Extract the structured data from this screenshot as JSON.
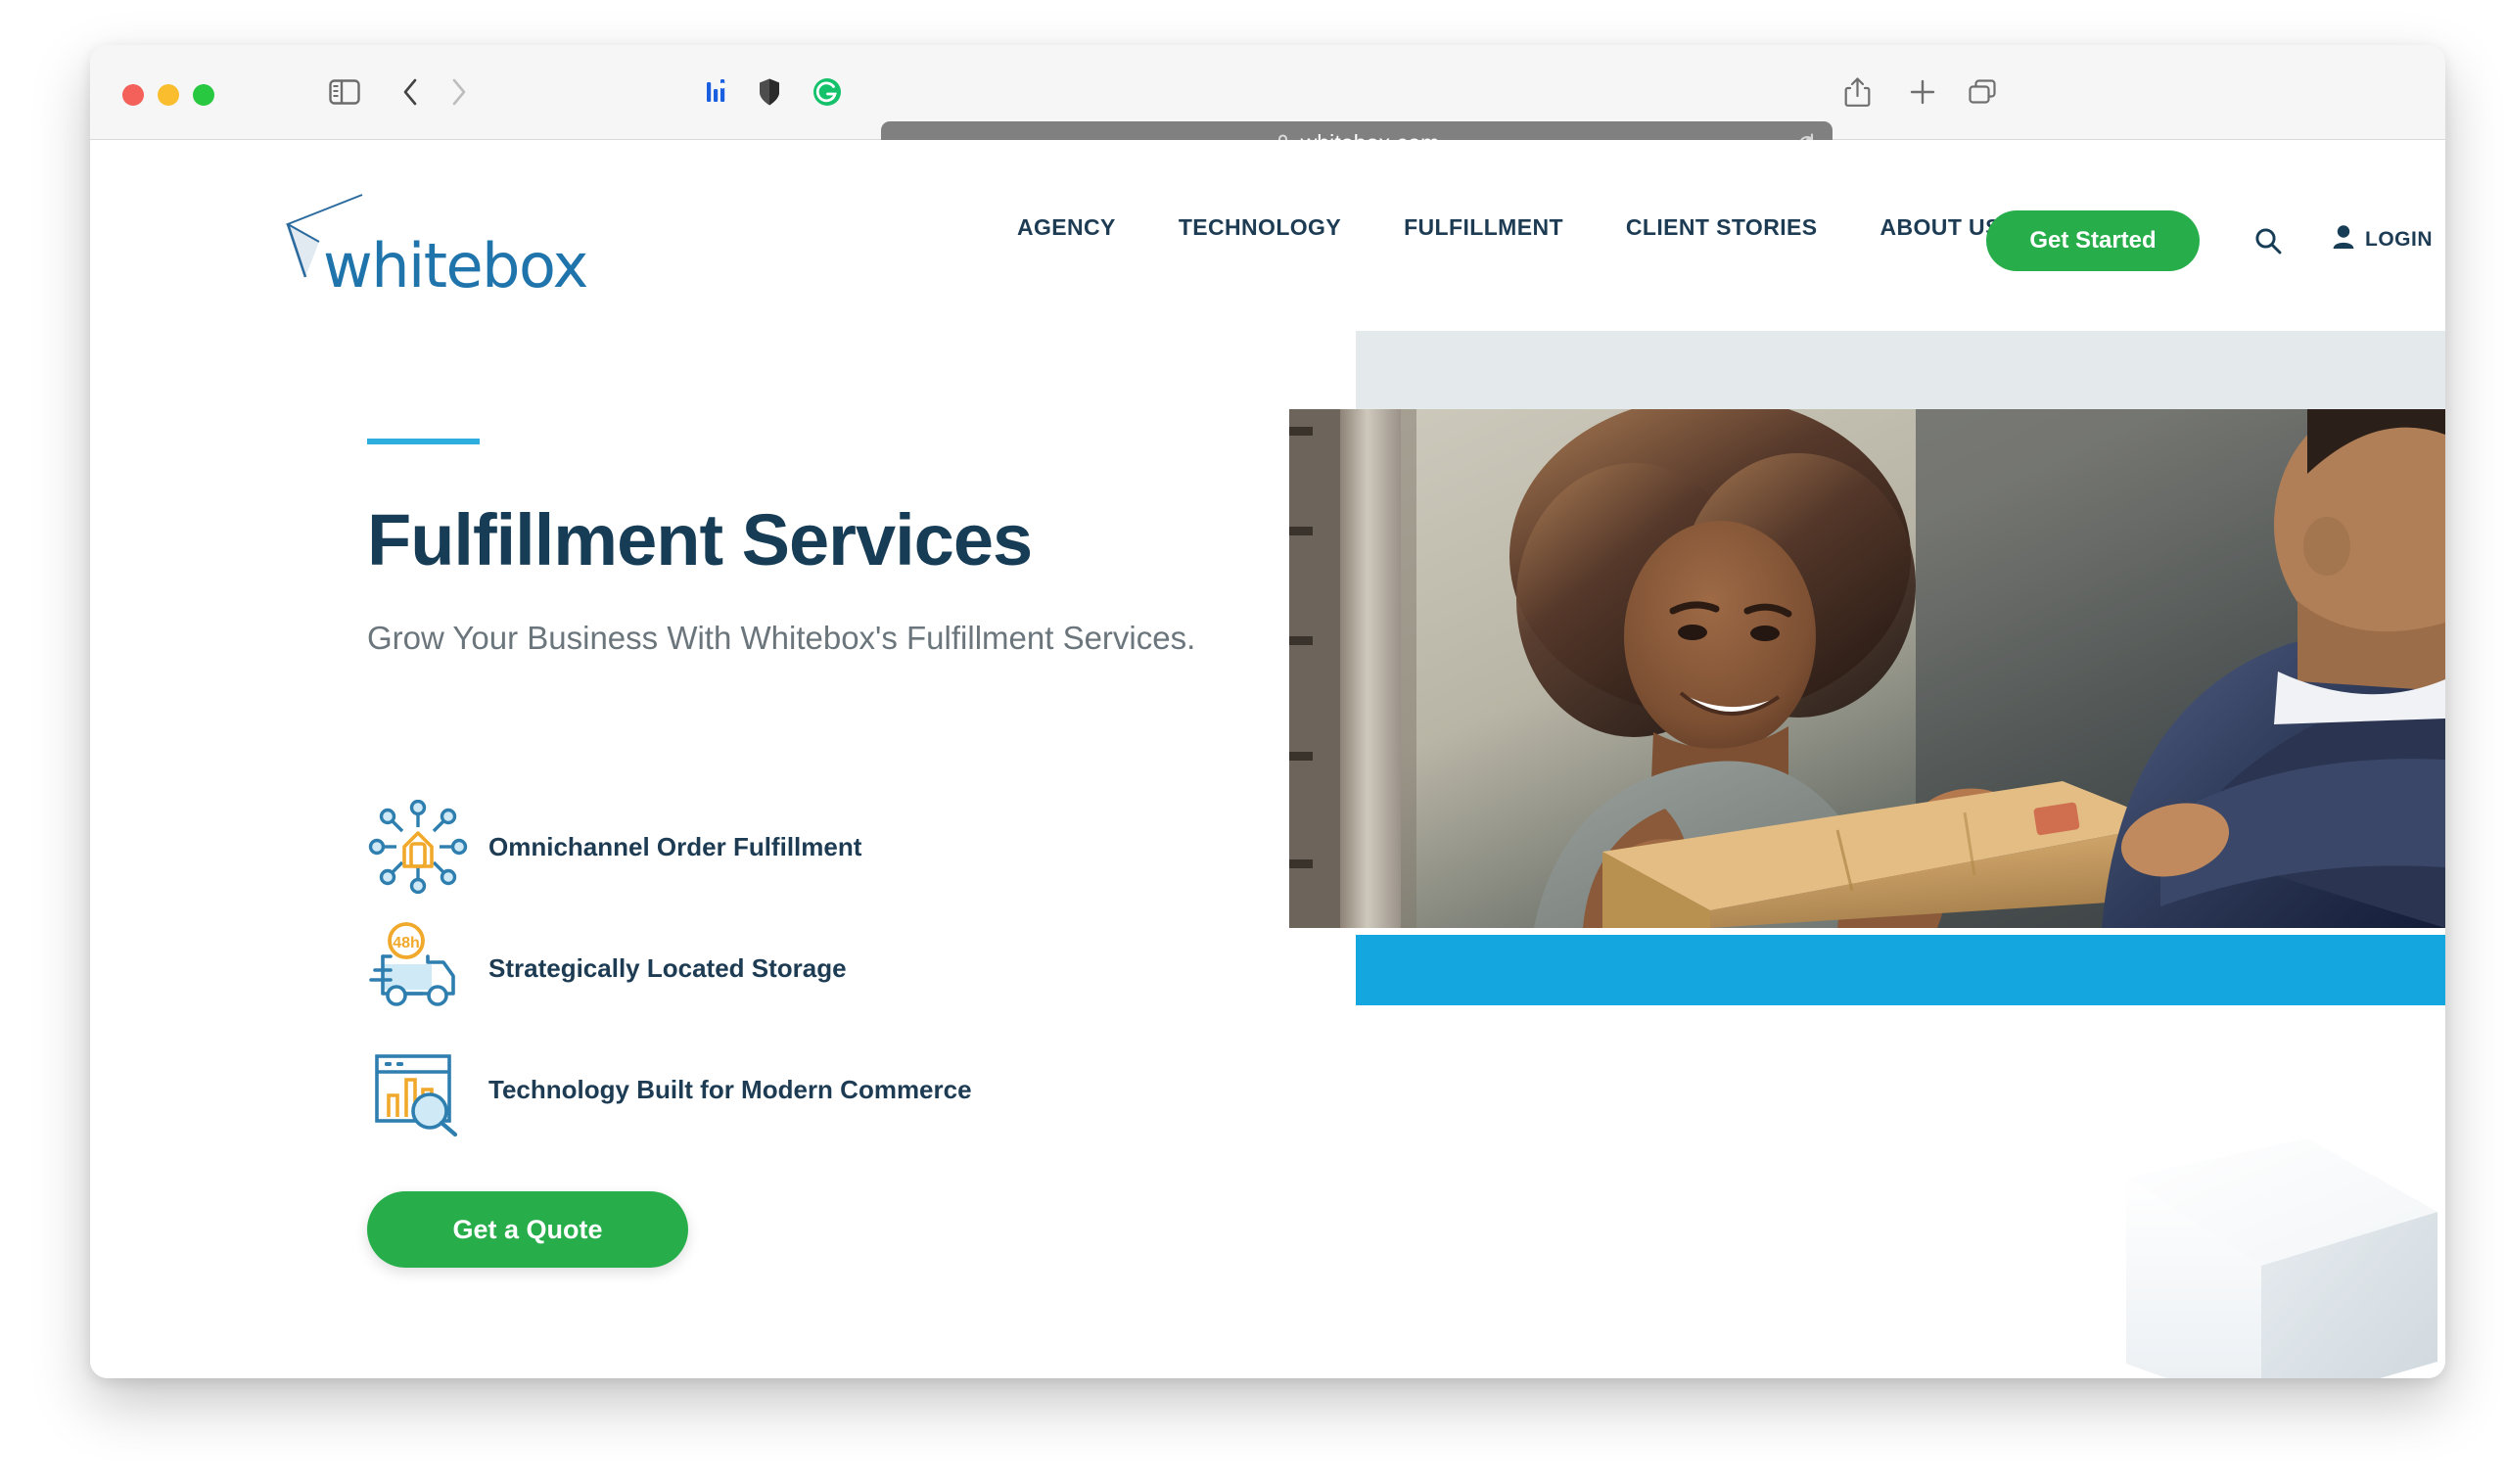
{
  "browser": {
    "url": "whitebox.com",
    "lock_icon": "lock-icon",
    "traffic_lights": [
      "close",
      "minimize",
      "maximize"
    ],
    "toolbar_icons": [
      "sidebar-toggle-icon",
      "back-arrow-icon",
      "forward-arrow-icon",
      "bar-chart-extension-icon",
      "shield-extension-icon",
      "grammarly-extension-icon",
      "reload-icon",
      "share-icon",
      "new-tab-icon",
      "tab-overview-icon"
    ]
  },
  "site": {
    "logo": {
      "wordmark": "whitebox",
      "mark": "arrow-cursor-icon",
      "color": "#1f74ab"
    },
    "nav": {
      "items": [
        {
          "label": "AGENCY"
        },
        {
          "label": "TECHNOLOGY"
        },
        {
          "label": "FULFILLMENT"
        },
        {
          "label": "CLIENT STORIES"
        },
        {
          "label": "ABOUT US"
        }
      ],
      "cta_label": "Get Started",
      "search_icon": "search-icon",
      "login_label": "LOGIN",
      "login_icon": "user-icon"
    }
  },
  "hero": {
    "accent_color": "#2eaede",
    "title": "Fulfillment Services",
    "subtitle": "Grow Your Business With Whitebox's Fulfillment Services.",
    "cta_label": "Get a Quote",
    "features": [
      {
        "label": "Omnichannel Order Fulfillment",
        "icon": "omnichannel-network-icon"
      },
      {
        "label": "Strategically Located Storage",
        "icon": "delivery-truck-48h-icon",
        "badge": "48h"
      },
      {
        "label": "Technology Built for Modern Commerce",
        "icon": "analytics-dashboard-icon"
      }
    ],
    "image_alt": "woman-receiving-package-photo",
    "cube_graphic": "white-3d-cube-icon",
    "colors": {
      "brand_green": "#27ae4b",
      "brand_blue": "#14a6de",
      "navy": "#1d3c54",
      "dark_panel": "#101f3e"
    }
  }
}
